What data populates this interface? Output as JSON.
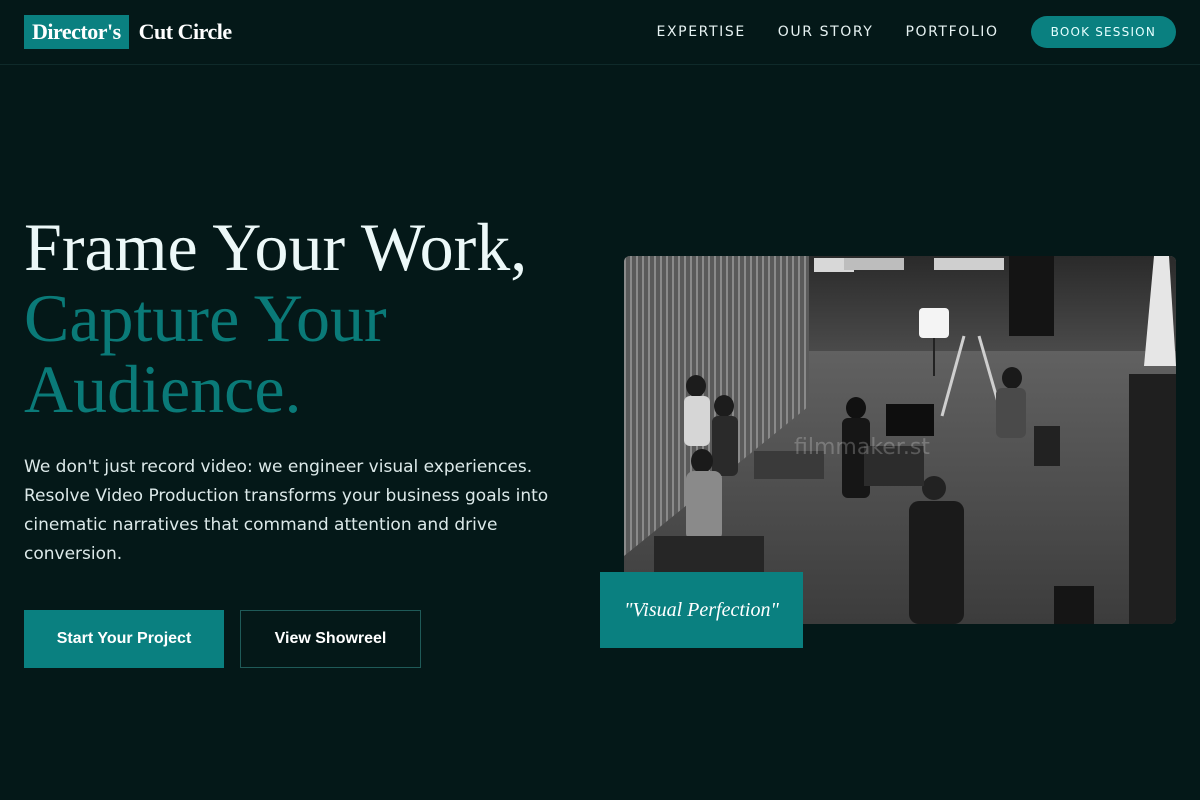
{
  "brand": {
    "badge": "Director's",
    "name": "Cut Circle"
  },
  "nav": {
    "items": [
      {
        "label": "EXPERTISE"
      },
      {
        "label": "OUR STORY"
      },
      {
        "label": "PORTFOLIO"
      }
    ],
    "cta_label": "BOOK SESSION"
  },
  "hero": {
    "title_line1": "Frame Your Work,",
    "title_line2": "Capture Your",
    "title_line3": "Audience.",
    "description": "We don't just record video: we engineer visual experiences. Resolve Video Production transforms your business goals into cinematic narratives that command attention and drive conversion.",
    "primary_button": "Start Your Project",
    "secondary_button": "View Showreel"
  },
  "image": {
    "watermark": "filmmaker.st",
    "badge": "\"Visual Perfection\""
  },
  "colors": {
    "background": "#041818",
    "accent": "#0a8080",
    "heading_teal": "#0a7a78"
  }
}
